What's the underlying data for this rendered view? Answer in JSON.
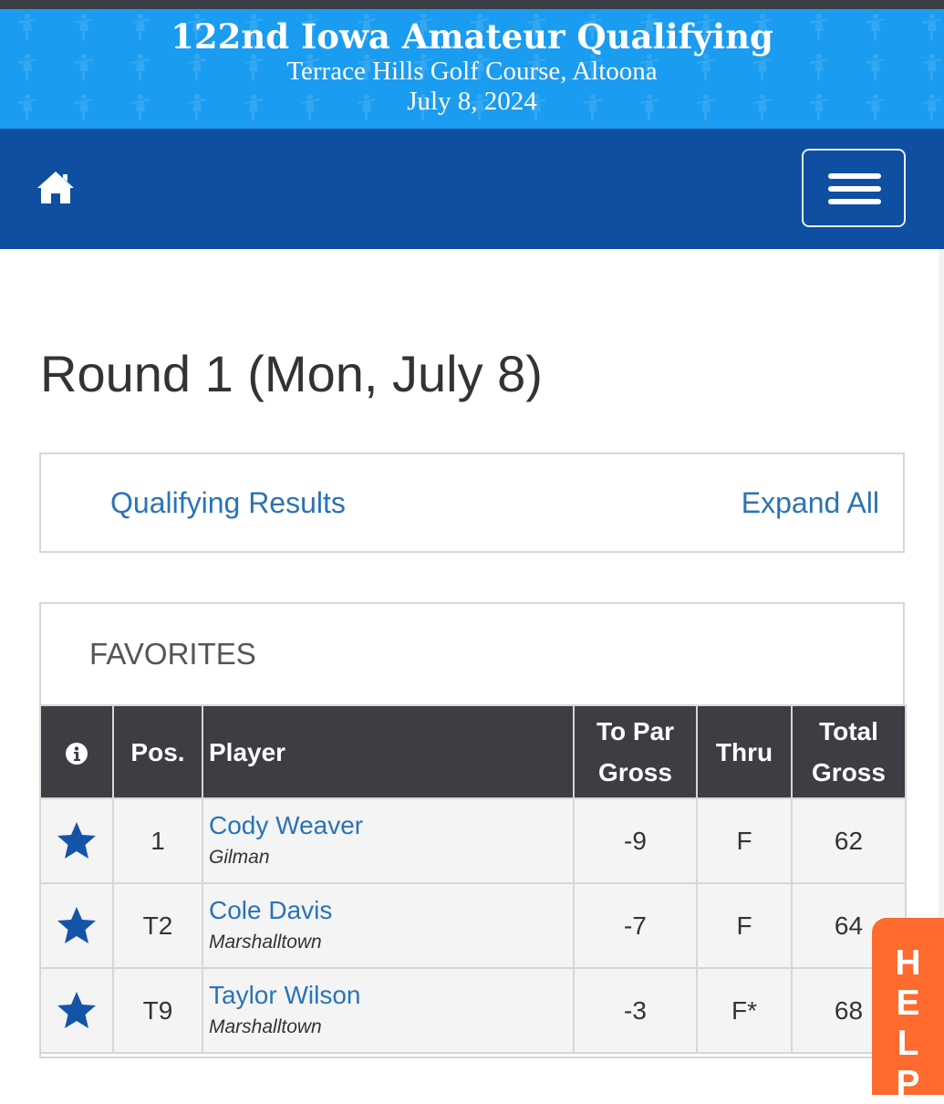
{
  "banner": {
    "title": "122nd Iowa Amateur Qualifying",
    "course": "Terrace Hills Golf Course, Altoona",
    "date": "July 8, 2024"
  },
  "nav": {
    "home_icon": "home-icon",
    "menu_icon": "hamburger-menu-icon"
  },
  "round": {
    "title": "Round 1 (Mon, July 8)"
  },
  "links": {
    "qualifying": "Qualifying Results",
    "expand": "Expand All"
  },
  "favorites": {
    "title": "FAVORITES",
    "headers": {
      "info_icon": "info-icon",
      "pos": "Pos.",
      "player": "Player",
      "topar_1": "To Par",
      "topar_2": "Gross",
      "thru": "Thru",
      "total_1": "Total",
      "total_2": "Gross"
    },
    "rows": [
      {
        "pos": "1",
        "name": "Cody Weaver",
        "city": "Gilman",
        "topar": "-9",
        "thru": "F",
        "total": "62"
      },
      {
        "pos": "T2",
        "name": "Cole Davis",
        "city": "Marshalltown",
        "topar": "-7",
        "thru": "F",
        "total": "64"
      },
      {
        "pos": "T9",
        "name": "Taylor Wilson",
        "city": "Marshalltown",
        "topar": "-3",
        "thru": "F*",
        "total": "68"
      }
    ]
  },
  "help": {
    "l1": "H",
    "l2": "E",
    "l3": "L",
    "l4": "P"
  },
  "colors": {
    "banner": "#1a9cf0",
    "navbar": "#0f4fa2",
    "link": "#2a73b5",
    "header_bg": "#3d3d44",
    "help": "#ff6a2e",
    "star": "#1454a8"
  }
}
